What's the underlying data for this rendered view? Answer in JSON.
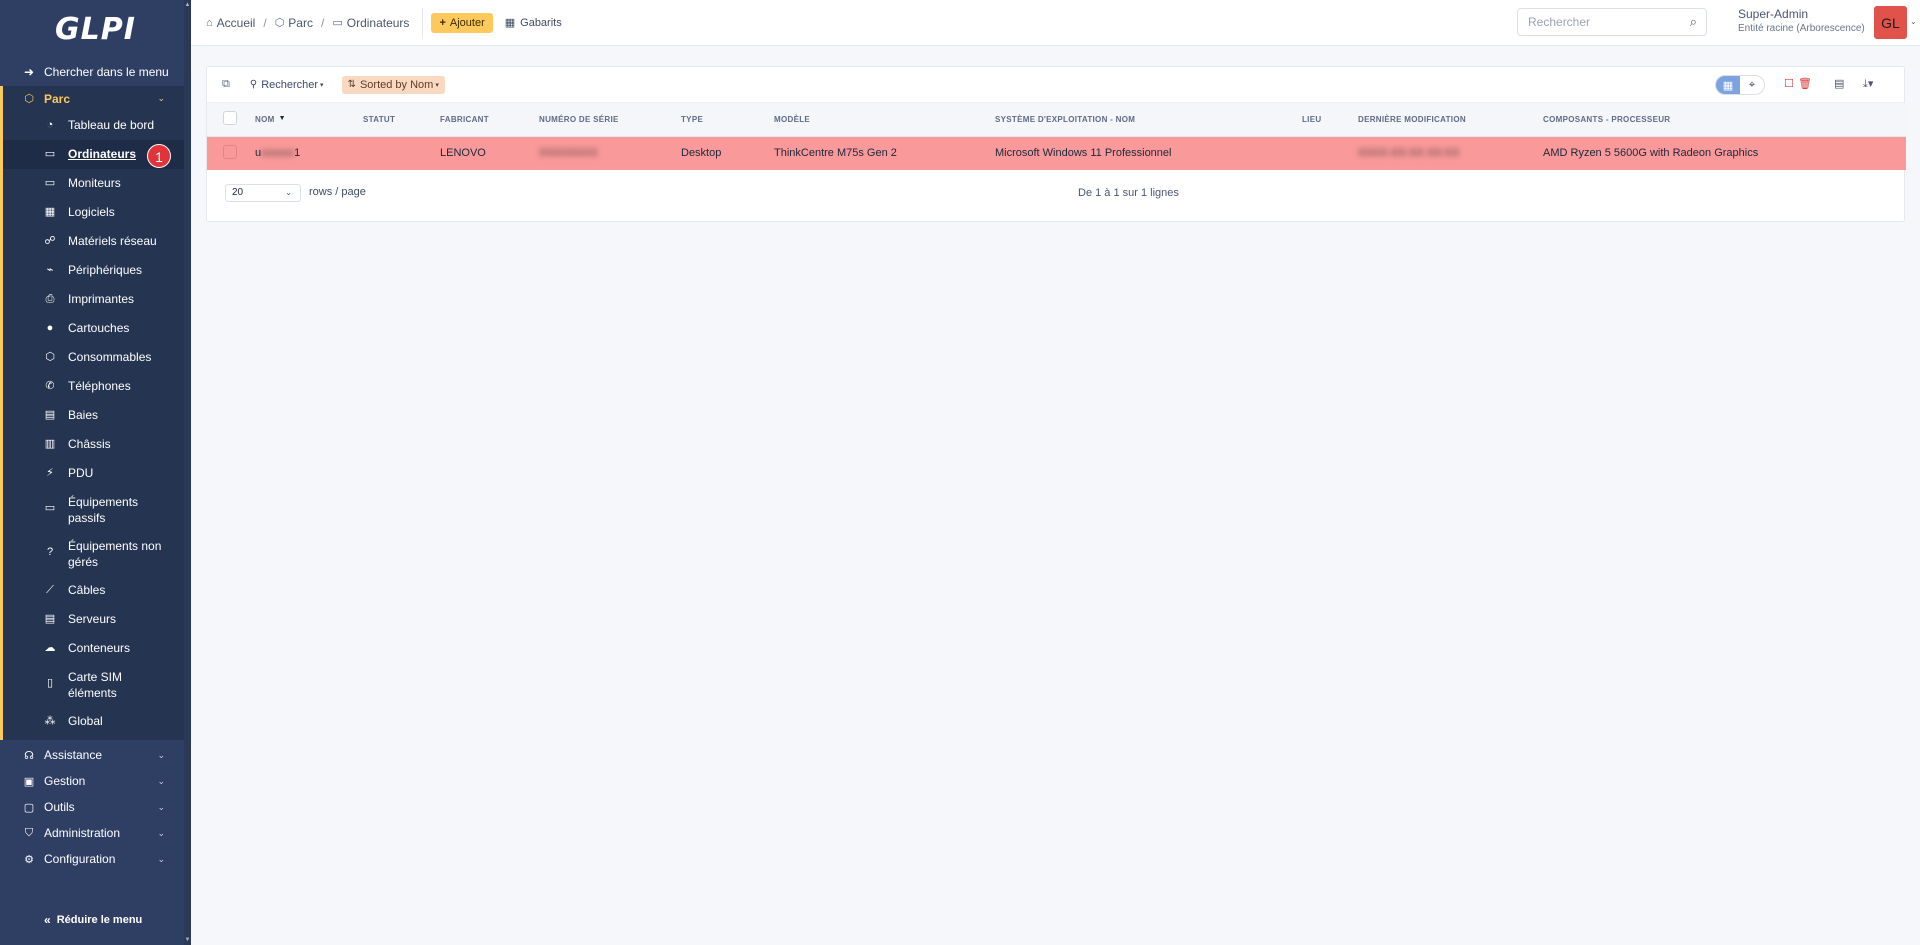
{
  "sidebar": {
    "logo": "GLPI",
    "search_label": "Chercher dans le menu",
    "active_section": "Parc",
    "items": [
      {
        "label": "Tableau de bord",
        "icon": "dashboard-icon"
      },
      {
        "label": "Ordinateurs",
        "icon": "laptop-icon",
        "selected": true
      },
      {
        "label": "Moniteurs",
        "icon": "monitor-icon"
      },
      {
        "label": "Logiciels",
        "icon": "apps-icon"
      },
      {
        "label": "Matériels réseau",
        "icon": "network-icon"
      },
      {
        "label": "Périphériques",
        "icon": "usb-icon"
      },
      {
        "label": "Imprimantes",
        "icon": "printer-icon"
      },
      {
        "label": "Cartouches",
        "icon": "droplet-icon"
      },
      {
        "label": "Consommables",
        "icon": "package-icon"
      },
      {
        "label": "Téléphones",
        "icon": "phone-icon"
      },
      {
        "label": "Baies",
        "icon": "server-icon"
      },
      {
        "label": "Châssis",
        "icon": "columns-icon"
      },
      {
        "label": "PDU",
        "icon": "plug-icon"
      },
      {
        "label": "Équipements passifs",
        "icon": "device-icon"
      },
      {
        "label": "Équipements non gérés",
        "icon": "question-icon"
      },
      {
        "label": "Câbles",
        "icon": "cable-icon"
      },
      {
        "label": "Serveurs",
        "icon": "server-icon"
      },
      {
        "label": "Conteneurs",
        "icon": "cloud-icon"
      },
      {
        "label": "Carte SIM éléments",
        "icon": "simcard-icon"
      },
      {
        "label": "Global",
        "icon": "global-icon"
      }
    ],
    "badge": "1",
    "sections": [
      {
        "label": "Assistance",
        "icon": "headset-icon"
      },
      {
        "label": "Gestion",
        "icon": "wallet-icon"
      },
      {
        "label": "Outils",
        "icon": "briefcase-icon"
      },
      {
        "label": "Administration",
        "icon": "shield-icon"
      },
      {
        "label": "Configuration",
        "icon": "gear-icon"
      }
    ],
    "collapse_label": "Réduire le menu"
  },
  "header": {
    "breadcrumb": [
      "Accueil",
      "Parc",
      "Ordinateurs"
    ],
    "add_label": "Ajouter",
    "templates_label": "Gabarits",
    "search_placeholder": "Rechercher",
    "user_name": "Super-Admin",
    "entity": "Entité racine (Arborescence)",
    "avatar_initials": "GL"
  },
  "toolbar": {
    "search_label": "Rechercher",
    "sorted_label": "Sorted by Nom"
  },
  "table": {
    "columns": [
      "NOM",
      "STATUT",
      "FABRICANT",
      "NUMÉRO DE SÉRIE",
      "TYPE",
      "MODÈLE",
      "SYSTÈME D'EXPLOITATION - NOM",
      "LIEU",
      "DERNIÈRE MODIFICATION",
      "COMPOSANTS - PROCESSEUR"
    ],
    "rows": [
      {
        "nom_start": "u",
        "nom_hidden": "xxxxxx",
        "nom_end": "1",
        "statut": "",
        "fabricant": "LENOVO",
        "serie": "XXXXXXXX",
        "type": "Desktop",
        "modele": "ThinkCentre M75s Gen 2",
        "os": "Microsoft Windows 11 Professionnel",
        "lieu": "",
        "modif": "XXXX-XX-XX XX:XX",
        "processeur": "AMD Ryzen 5 5600G with Radeon Graphics"
      }
    ]
  },
  "footer": {
    "rows_per_page": "20",
    "rows_label": "rows / page",
    "paging": "De 1 à 1 sur 1 lignes"
  },
  "colors": {
    "sidebar_bg": "#2f3f64",
    "accent": "#fec95c",
    "highlight_row": "#f9999a",
    "badge": "#e0343a"
  }
}
